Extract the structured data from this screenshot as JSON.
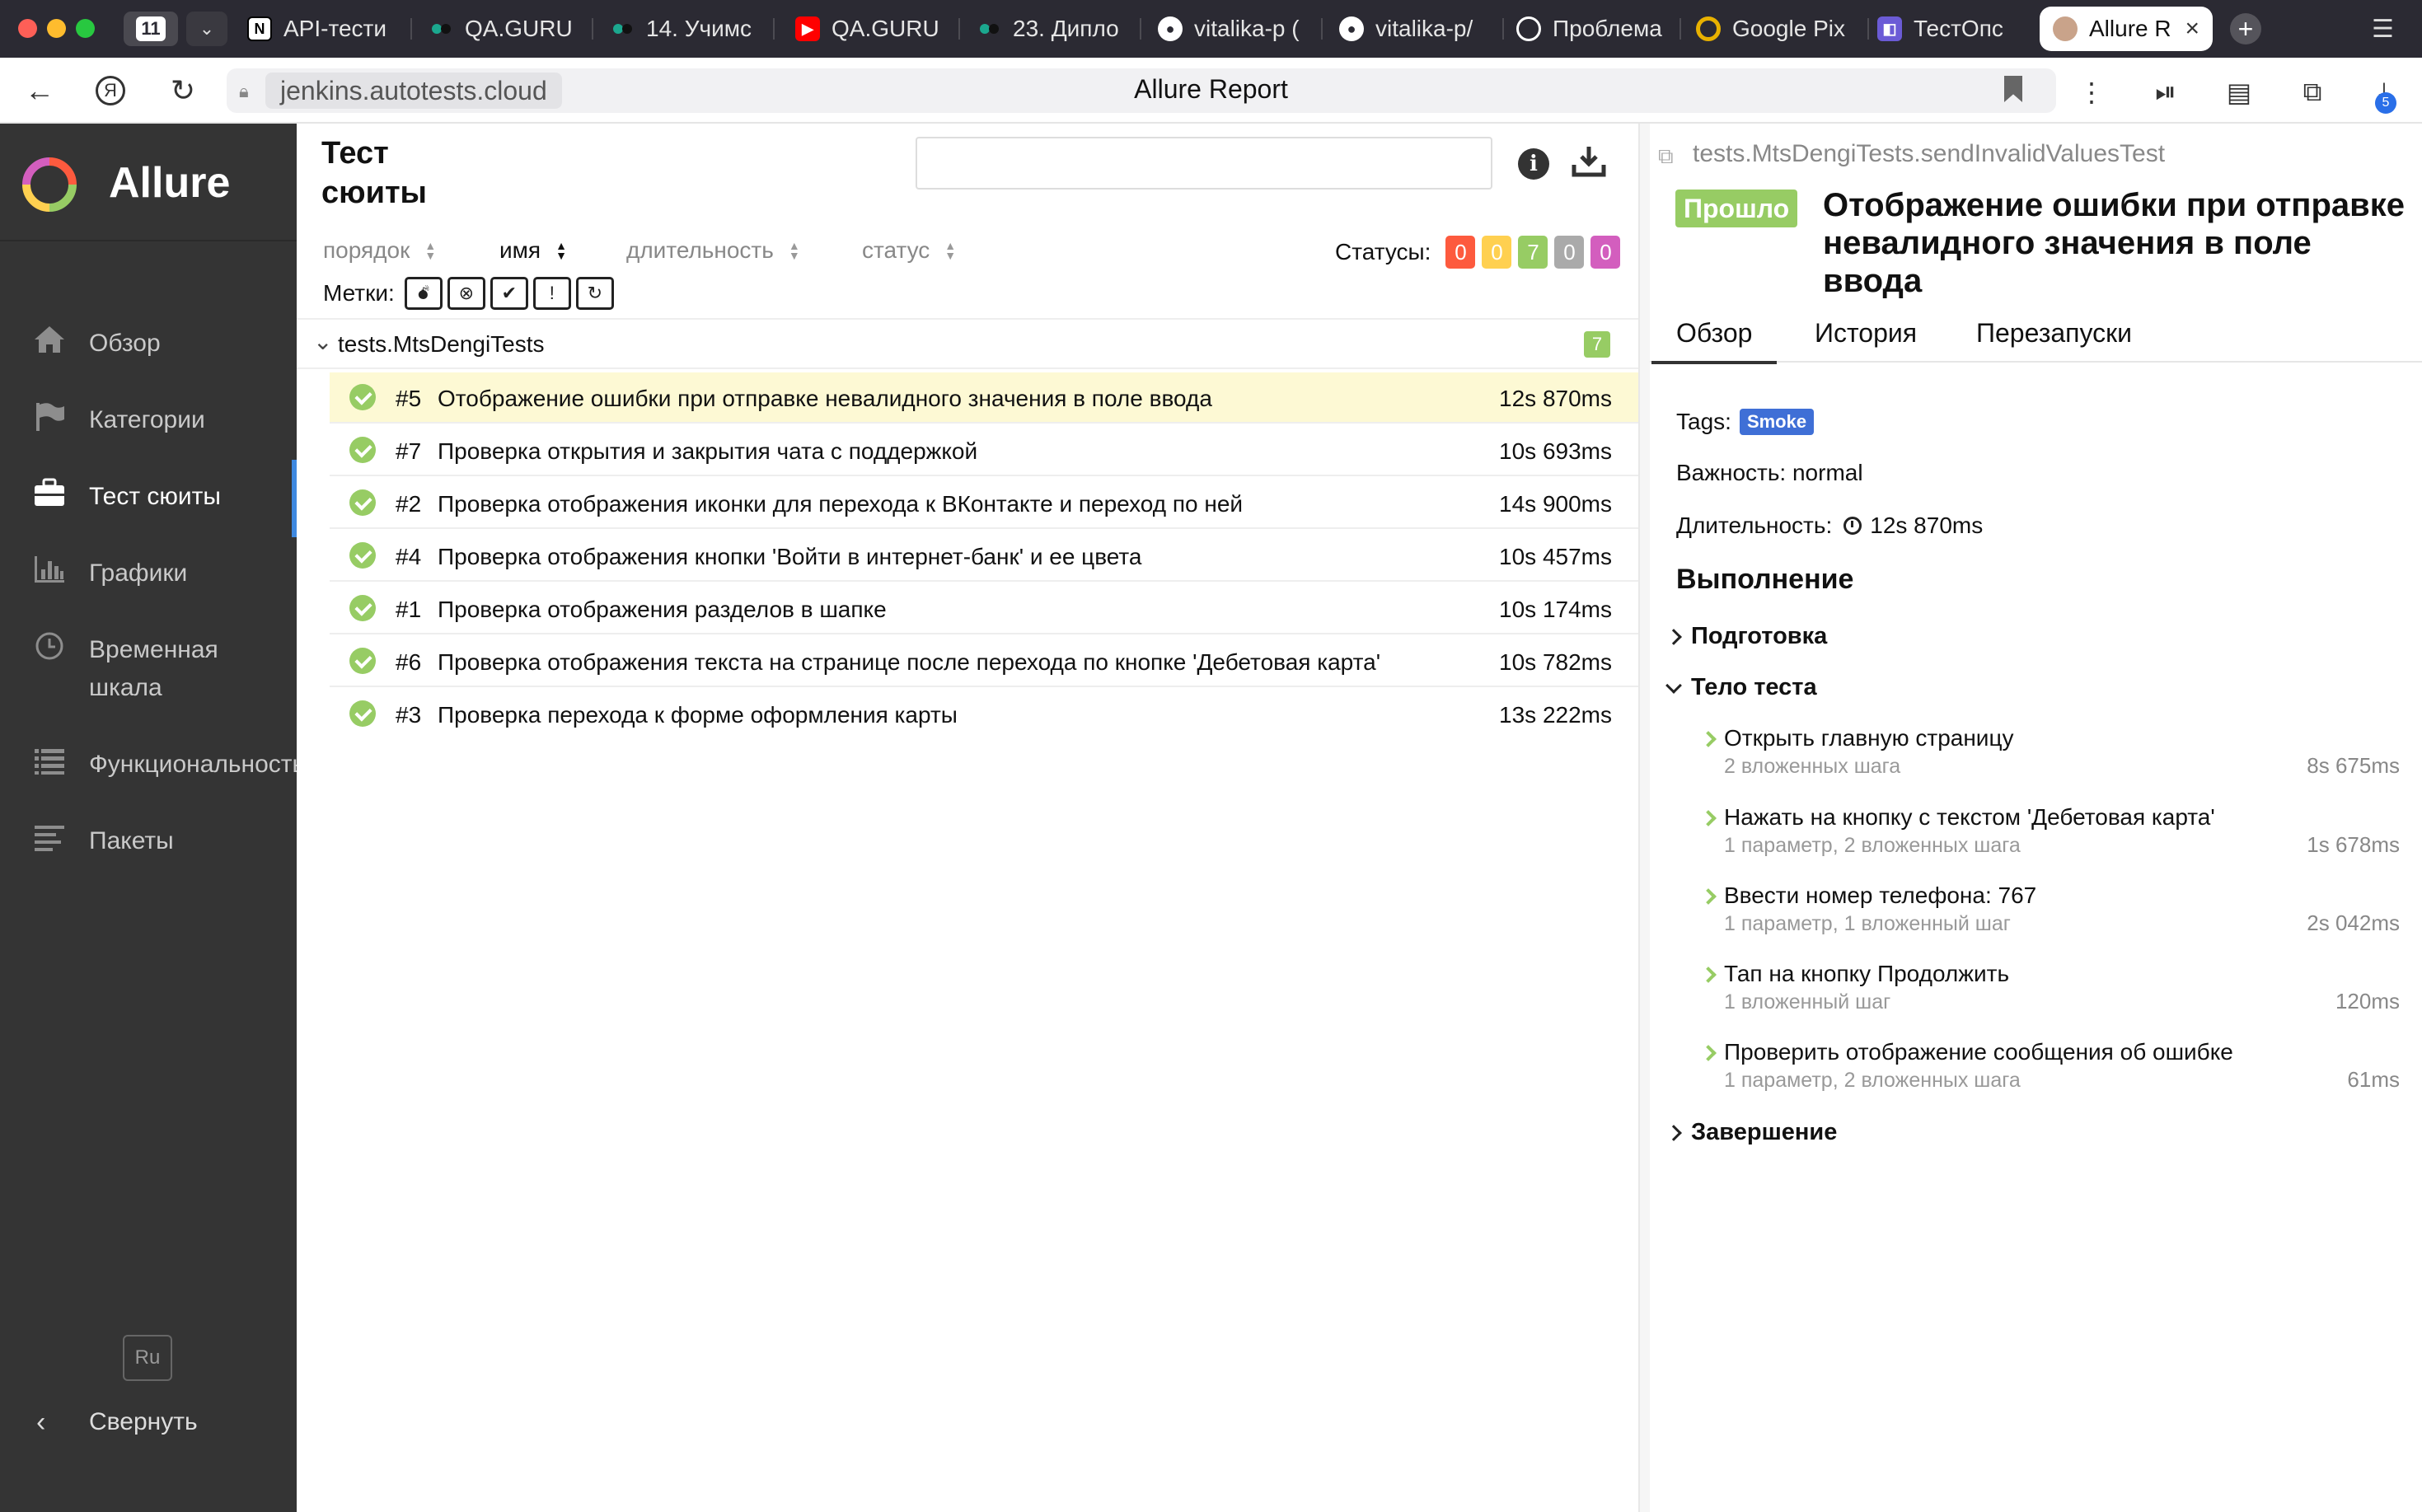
{
  "browser": {
    "tab_count": "11",
    "tabs": [
      {
        "title": "API-тести",
        "favicon": "notion-icon",
        "color": "#ffffff"
      },
      {
        "title": "QA.GURU",
        "favicon": "dot-icon",
        "color": "#0a7a73"
      },
      {
        "title": "14. Учимс",
        "favicon": "dot-icon",
        "color": "#0a7a73"
      },
      {
        "title": "QA.GURU",
        "favicon": "youtube-icon",
        "color": "#ff0000"
      },
      {
        "title": "23. Дипло",
        "favicon": "dot-icon",
        "color": "#0a7a73"
      },
      {
        "title": "vitalika-p (",
        "favicon": "github-icon",
        "color": "#ffffff"
      },
      {
        "title": "vitalika-p/",
        "favicon": "github-icon",
        "color": "#ffffff"
      },
      {
        "title": "Проблема",
        "favicon": "openai-icon",
        "color": "#ffffff"
      },
      {
        "title": "Google Pix",
        "favicon": "google-icon",
        "color": "#e8b100"
      },
      {
        "title": "ТестОпс",
        "favicon": "testops-icon",
        "color": "#6b5bd6"
      }
    ],
    "active_tab": "Allure R",
    "url_host": "jenkins.autotests.cloud",
    "page_title": "Allure Report",
    "downloads_badge": "5"
  },
  "sidebar": {
    "brand": "Allure",
    "items": [
      {
        "label": "Обзор",
        "icon": "home-icon"
      },
      {
        "label": "Категории",
        "icon": "flag-icon"
      },
      {
        "label": "Тест сюиты",
        "icon": "briefcase-icon"
      },
      {
        "label": "Графики",
        "icon": "bar-chart-icon"
      },
      {
        "label": "Временная шкала",
        "icon": "clock-icon"
      },
      {
        "label": "Функциональность",
        "icon": "list-icon"
      },
      {
        "label": "Пакеты",
        "icon": "align-left-icon"
      }
    ],
    "lang": "Ru",
    "collapse": "Свернуть",
    "accent": "#3f89e0"
  },
  "suites": {
    "title": "Тест сюиты",
    "sort": {
      "order": "порядок",
      "name": "имя",
      "duration": "длительность",
      "status": "статус"
    },
    "statuses_label": "Статусы:",
    "statuses": [
      {
        "value": "0",
        "color": "#fd5a3e"
      },
      {
        "value": "0",
        "color": "#ffd050"
      },
      {
        "value": "7",
        "color": "#97cc64"
      },
      {
        "value": "0",
        "color": "#aaaaaa"
      },
      {
        "value": "0",
        "color": "#d35ebe"
      }
    ],
    "marks_label": "Метки:",
    "group_name": "tests.MtsDengiTests",
    "group_count": "7",
    "rows": [
      {
        "num": "#5",
        "name": "Отображение ошибки при отправке невалидного значения в поле ввода",
        "time": "12s 870ms"
      },
      {
        "num": "#7",
        "name": "Проверка открытия и закрытия чата с поддержкой",
        "time": "10s 693ms"
      },
      {
        "num": "#2",
        "name": "Проверка отображения иконки для перехода к ВКонтакте и переход по ней",
        "time": "14s 900ms"
      },
      {
        "num": "#4",
        "name": "Проверка отображения кнопки 'Войти в интернет-банк' и ее цвета",
        "time": "10s 457ms"
      },
      {
        "num": "#1",
        "name": "Проверка отображения разделов в шапке",
        "time": "10s 174ms"
      },
      {
        "num": "#6",
        "name": "Проверка отображения текста на странице после перехода по кнопке 'Дебетовая карта'",
        "time": "10s 782ms"
      },
      {
        "num": "#3",
        "name": "Проверка перехода к форме оформления карты",
        "time": "13s 222ms"
      }
    ]
  },
  "detail": {
    "full_name": "tests.MtsDengiTests.sendInvalidValuesTest",
    "status": "Прошло",
    "title": "Отображение ошибки при отправке невалидного значения в поле ввода",
    "tabs": [
      "Обзор",
      "История",
      "Перезапуски"
    ],
    "tags_label": "Tags:",
    "tag": "Smoke",
    "severity": "Важность: normal",
    "duration_label": "Длительность:",
    "duration": "12s 870ms",
    "execution_title": "Выполнение",
    "setup": "Подготовка",
    "body": "Тело теста",
    "teardown": "Завершение",
    "steps": [
      {
        "title": "Открыть главную страницу",
        "sub": "2 вложенных шага",
        "time": "8s 675ms"
      },
      {
        "title": "Нажать на кнопку с текстом 'Дебетовая карта'",
        "sub": "1 параметр, 2 вложенных шага",
        "time": "1s 678ms"
      },
      {
        "title": "Ввести номер телефона: 767",
        "sub": "1 параметр, 1 вложенный шаг",
        "time": "2s 042ms"
      },
      {
        "title": "Тап на кнопку Продолжить",
        "sub": "1 вложенный шаг",
        "time": "120ms"
      },
      {
        "title": "Проверить отображение сообщения об ошибке",
        "sub": "1 параметр, 2 вложенных шага",
        "time": "61ms"
      }
    ]
  }
}
